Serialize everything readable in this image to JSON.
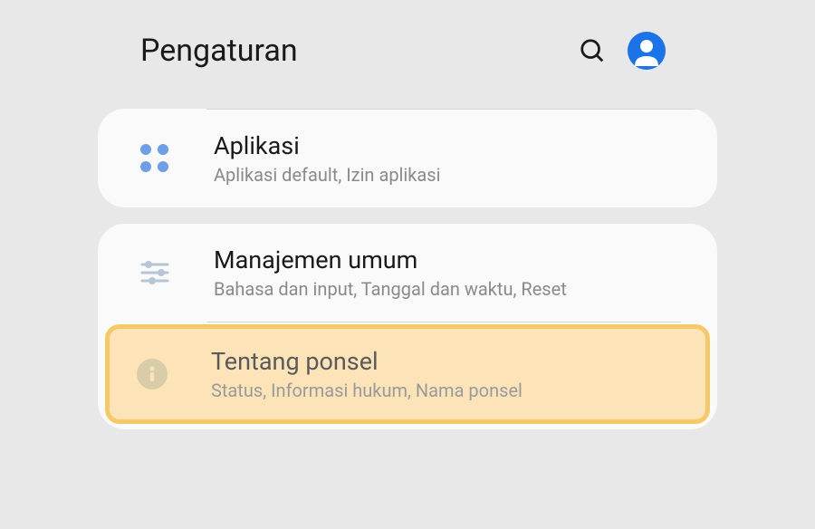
{
  "header": {
    "title": "Pengaturan"
  },
  "sections": {
    "apps": {
      "title": "Aplikasi",
      "subtitle": "Aplikasi default, Izin aplikasi"
    },
    "general": {
      "title": "Manajemen umum",
      "subtitle": "Bahasa dan input, Tanggal dan waktu, Reset"
    },
    "about": {
      "title": "Tentang ponsel",
      "subtitle": "Status, Informasi hukum, Nama ponsel"
    }
  }
}
